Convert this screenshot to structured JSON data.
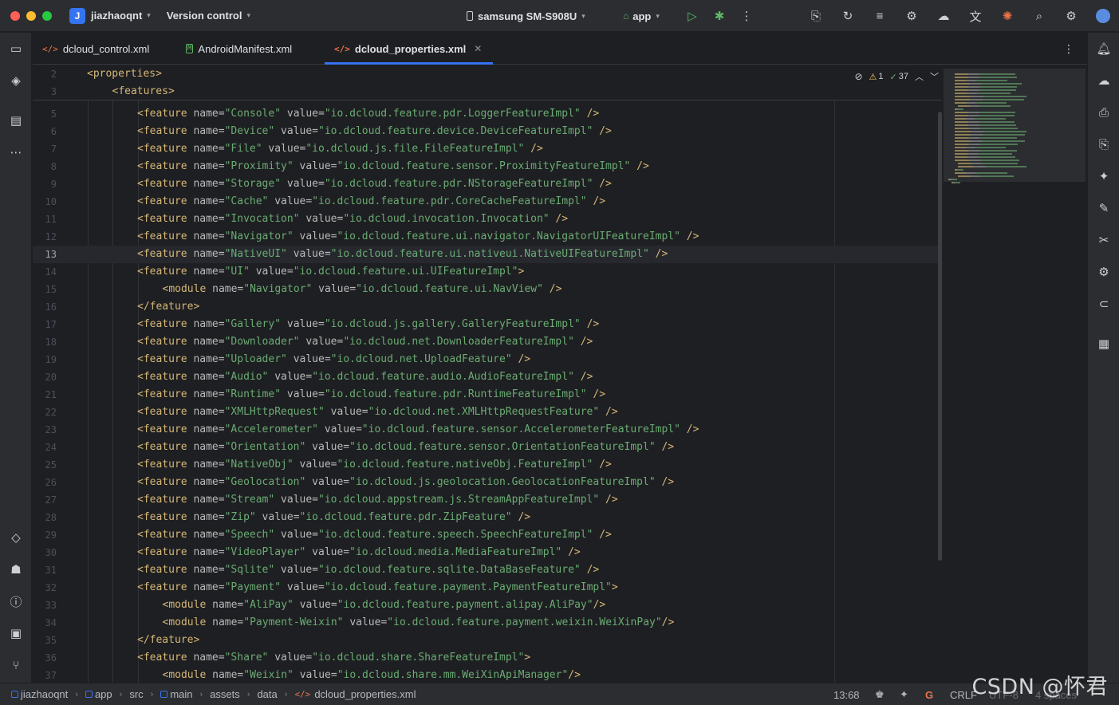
{
  "titlebar": {
    "project_initial": "J",
    "project_name": "jiazhaoqnt",
    "version_control": "Version control",
    "device": "samsung SM-S908U",
    "run_config": "app"
  },
  "tabs": [
    {
      "icon": "</>",
      "label": "dcloud_control.xml"
    },
    {
      "icon": "M",
      "label": "AndroidManifest.xml"
    },
    {
      "icon": "</>",
      "label": "dcloud_properties.xml",
      "active": true
    }
  ],
  "inspection": {
    "warnings": "1",
    "ok": "37"
  },
  "sticky_lines": [
    {
      "n": "2",
      "indent": 0,
      "text": "<properties>"
    },
    {
      "n": "3",
      "indent": 1,
      "text": "<features>"
    }
  ],
  "lines": [
    {
      "n": "5",
      "indent": 2,
      "kind": "feature",
      "name": "Console",
      "value": "io.dcloud.feature.pdr.LoggerFeatureImpl",
      "close": " />"
    },
    {
      "n": "6",
      "indent": 2,
      "kind": "feature",
      "name": "Device",
      "value": "io.dcloud.feature.device.DeviceFeatureImpl",
      "close": " />"
    },
    {
      "n": "7",
      "indent": 2,
      "kind": "feature",
      "name": "File",
      "value": "io.dcloud.js.file.FileFeatureImpl",
      "close": " />"
    },
    {
      "n": "8",
      "indent": 2,
      "kind": "feature",
      "name": "Proximity",
      "value": "io.dcloud.feature.sensor.ProximityFeatureImpl",
      "close": " />"
    },
    {
      "n": "9",
      "indent": 2,
      "kind": "feature",
      "name": "Storage",
      "value": "io.dcloud.feature.pdr.NStorageFeatureImpl",
      "close": " />"
    },
    {
      "n": "10",
      "indent": 2,
      "kind": "feature",
      "name": "Cache",
      "value": "io.dcloud.feature.pdr.CoreCacheFeatureImpl",
      "close": " />"
    },
    {
      "n": "11",
      "indent": 2,
      "kind": "feature",
      "name": "Invocation",
      "value": "io.dcloud.invocation.Invocation",
      "close": " />"
    },
    {
      "n": "12",
      "indent": 2,
      "kind": "feature",
      "name": "Navigator",
      "value": "io.dcloud.feature.ui.navigator.NavigatorUIFeatureImpl",
      "close": " />"
    },
    {
      "n": "13",
      "indent": 2,
      "kind": "feature",
      "name": "NativeUI",
      "value": "io.dcloud.feature.ui.nativeui.NativeUIFeatureImpl",
      "close": " />",
      "current": true
    },
    {
      "n": "14",
      "indent": 2,
      "kind": "feature",
      "name": "UI",
      "value": "io.dcloud.feature.ui.UIFeatureImpl",
      "close": ">"
    },
    {
      "n": "15",
      "indent": 3,
      "kind": "module",
      "name": "Navigator",
      "value": "io.dcloud.feature.ui.NavView",
      "close": " />"
    },
    {
      "n": "16",
      "indent": 2,
      "kind": "end",
      "text": "</feature>"
    },
    {
      "n": "17",
      "indent": 2,
      "kind": "feature",
      "name": "Gallery",
      "value": "io.dcloud.js.gallery.GalleryFeatureImpl",
      "close": " />"
    },
    {
      "n": "18",
      "indent": 2,
      "kind": "feature",
      "name": "Downloader",
      "value": "io.dcloud.net.DownloaderFeatureImpl",
      "close": " />"
    },
    {
      "n": "19",
      "indent": 2,
      "kind": "feature",
      "name": "Uploader",
      "value": "io.dcloud.net.UploadFeature",
      "close": " />"
    },
    {
      "n": "20",
      "indent": 2,
      "kind": "feature",
      "name": "Audio",
      "value": "io.dcloud.feature.audio.AudioFeatureImpl",
      "close": " />"
    },
    {
      "n": "21",
      "indent": 2,
      "kind": "feature",
      "name": "Runtime",
      "value": "io.dcloud.feature.pdr.RuntimeFeatureImpl",
      "close": " />"
    },
    {
      "n": "22",
      "indent": 2,
      "kind": "feature",
      "name": "XMLHttpRequest",
      "value": "io.dcloud.net.XMLHttpRequestFeature",
      "close": " />"
    },
    {
      "n": "23",
      "indent": 2,
      "kind": "feature",
      "name": "Accelerometer",
      "value": "io.dcloud.feature.sensor.AccelerometerFeatureImpl",
      "close": " />"
    },
    {
      "n": "24",
      "indent": 2,
      "kind": "feature",
      "name": "Orientation",
      "value": "io.dcloud.feature.sensor.OrientationFeatureImpl",
      "close": " />"
    },
    {
      "n": "25",
      "indent": 2,
      "kind": "feature",
      "name": "NativeObj",
      "value": "io.dcloud.feature.nativeObj.FeatureImpl",
      "close": " />"
    },
    {
      "n": "26",
      "indent": 2,
      "kind": "feature",
      "name": "Geolocation",
      "value": "io.dcloud.js.geolocation.GeolocationFeatureImpl",
      "close": " />"
    },
    {
      "n": "27",
      "indent": 2,
      "kind": "feature",
      "name": "Stream",
      "value": "io.dcloud.appstream.js.StreamAppFeatureImpl",
      "close": " />"
    },
    {
      "n": "28",
      "indent": 2,
      "kind": "feature",
      "name": "Zip",
      "value": "io.dcloud.feature.pdr.ZipFeature",
      "close": " />"
    },
    {
      "n": "29",
      "indent": 2,
      "kind": "feature",
      "name": "Speech",
      "value": "io.dcloud.feature.speech.SpeechFeatureImpl",
      "close": " />"
    },
    {
      "n": "30",
      "indent": 2,
      "kind": "feature",
      "name": "VideoPlayer",
      "value": "io.dcloud.media.MediaFeatureImpl",
      "close": " />"
    },
    {
      "n": "31",
      "indent": 2,
      "kind": "feature",
      "name": "Sqlite",
      "value": "io.dcloud.feature.sqlite.DataBaseFeature",
      "close": " />"
    },
    {
      "n": "32",
      "indent": 2,
      "kind": "feature",
      "name": "Payment",
      "value": "io.dcloud.feature.payment.PaymentFeatureImpl",
      "close": ">"
    },
    {
      "n": "33",
      "indent": 3,
      "kind": "module",
      "name": "AliPay",
      "value": "io.dcloud.feature.payment.alipay.AliPay",
      "close": "/>"
    },
    {
      "n": "34",
      "indent": 3,
      "kind": "module",
      "name": "Payment-Weixin",
      "value": "io.dcloud.feature.payment.weixin.WeiXinPay",
      "close": "/>"
    },
    {
      "n": "35",
      "indent": 2,
      "kind": "end",
      "text": "</feature>"
    },
    {
      "n": "36",
      "indent": 2,
      "kind": "feature",
      "name": "Share",
      "value": "io.dcloud.share.ShareFeatureImpl",
      "close": ">"
    },
    {
      "n": "37",
      "indent": 3,
      "kind": "module",
      "name": "Weixin",
      "value": "io.dcloud.share.mm.WeiXinApiManager",
      "close": "/>"
    }
  ],
  "statusbar": {
    "breadcrumb": [
      "jiazhaoqnt",
      "app",
      "src",
      "main",
      "assets",
      "data",
      "dcloud_properties.xml"
    ],
    "position": "13:68",
    "line_ending": "CRLF",
    "encoding": "UTF-8",
    "indent": "4 spaces"
  },
  "watermark": "CSDN @怀君",
  "colors": {
    "tag": "#d5b778",
    "attr": "#bababa",
    "string": "#6aab73",
    "accent": "#3574f0"
  }
}
